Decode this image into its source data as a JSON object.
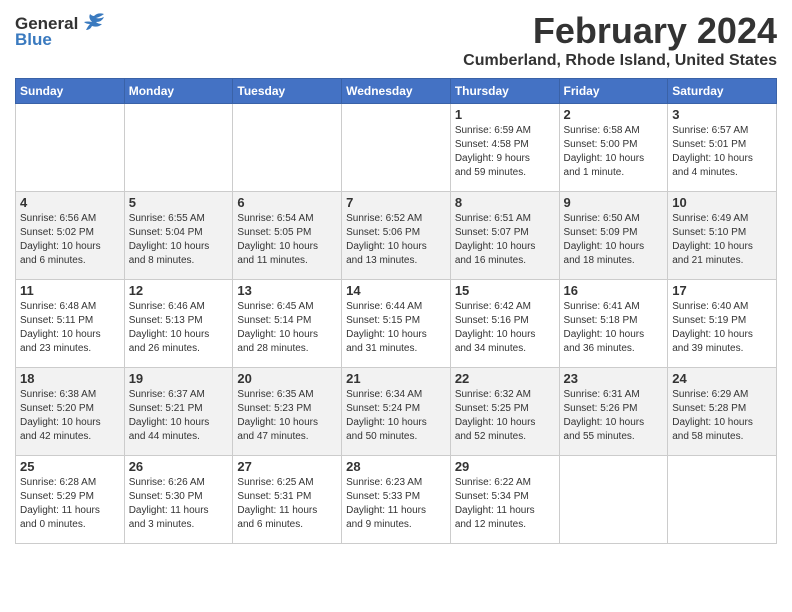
{
  "header": {
    "logo_line1": "General",
    "logo_line2": "Blue",
    "title": "February 2024",
    "subtitle": "Cumberland, Rhode Island, United States"
  },
  "days_of_week": [
    "Sunday",
    "Monday",
    "Tuesday",
    "Wednesday",
    "Thursday",
    "Friday",
    "Saturday"
  ],
  "weeks": [
    {
      "cells": [
        {
          "day": "",
          "info": ""
        },
        {
          "day": "",
          "info": ""
        },
        {
          "day": "",
          "info": ""
        },
        {
          "day": "",
          "info": ""
        },
        {
          "day": "1",
          "info": "Sunrise: 6:59 AM\nSunset: 4:58 PM\nDaylight: 9 hours\nand 59 minutes."
        },
        {
          "day": "2",
          "info": "Sunrise: 6:58 AM\nSunset: 5:00 PM\nDaylight: 10 hours\nand 1 minute."
        },
        {
          "day": "3",
          "info": "Sunrise: 6:57 AM\nSunset: 5:01 PM\nDaylight: 10 hours\nand 4 minutes."
        }
      ]
    },
    {
      "cells": [
        {
          "day": "4",
          "info": "Sunrise: 6:56 AM\nSunset: 5:02 PM\nDaylight: 10 hours\nand 6 minutes."
        },
        {
          "day": "5",
          "info": "Sunrise: 6:55 AM\nSunset: 5:04 PM\nDaylight: 10 hours\nand 8 minutes."
        },
        {
          "day": "6",
          "info": "Sunrise: 6:54 AM\nSunset: 5:05 PM\nDaylight: 10 hours\nand 11 minutes."
        },
        {
          "day": "7",
          "info": "Sunrise: 6:52 AM\nSunset: 5:06 PM\nDaylight: 10 hours\nand 13 minutes."
        },
        {
          "day": "8",
          "info": "Sunrise: 6:51 AM\nSunset: 5:07 PM\nDaylight: 10 hours\nand 16 minutes."
        },
        {
          "day": "9",
          "info": "Sunrise: 6:50 AM\nSunset: 5:09 PM\nDaylight: 10 hours\nand 18 minutes."
        },
        {
          "day": "10",
          "info": "Sunrise: 6:49 AM\nSunset: 5:10 PM\nDaylight: 10 hours\nand 21 minutes."
        }
      ]
    },
    {
      "cells": [
        {
          "day": "11",
          "info": "Sunrise: 6:48 AM\nSunset: 5:11 PM\nDaylight: 10 hours\nand 23 minutes."
        },
        {
          "day": "12",
          "info": "Sunrise: 6:46 AM\nSunset: 5:13 PM\nDaylight: 10 hours\nand 26 minutes."
        },
        {
          "day": "13",
          "info": "Sunrise: 6:45 AM\nSunset: 5:14 PM\nDaylight: 10 hours\nand 28 minutes."
        },
        {
          "day": "14",
          "info": "Sunrise: 6:44 AM\nSunset: 5:15 PM\nDaylight: 10 hours\nand 31 minutes."
        },
        {
          "day": "15",
          "info": "Sunrise: 6:42 AM\nSunset: 5:16 PM\nDaylight: 10 hours\nand 34 minutes."
        },
        {
          "day": "16",
          "info": "Sunrise: 6:41 AM\nSunset: 5:18 PM\nDaylight: 10 hours\nand 36 minutes."
        },
        {
          "day": "17",
          "info": "Sunrise: 6:40 AM\nSunset: 5:19 PM\nDaylight: 10 hours\nand 39 minutes."
        }
      ]
    },
    {
      "cells": [
        {
          "day": "18",
          "info": "Sunrise: 6:38 AM\nSunset: 5:20 PM\nDaylight: 10 hours\nand 42 minutes."
        },
        {
          "day": "19",
          "info": "Sunrise: 6:37 AM\nSunset: 5:21 PM\nDaylight: 10 hours\nand 44 minutes."
        },
        {
          "day": "20",
          "info": "Sunrise: 6:35 AM\nSunset: 5:23 PM\nDaylight: 10 hours\nand 47 minutes."
        },
        {
          "day": "21",
          "info": "Sunrise: 6:34 AM\nSunset: 5:24 PM\nDaylight: 10 hours\nand 50 minutes."
        },
        {
          "day": "22",
          "info": "Sunrise: 6:32 AM\nSunset: 5:25 PM\nDaylight: 10 hours\nand 52 minutes."
        },
        {
          "day": "23",
          "info": "Sunrise: 6:31 AM\nSunset: 5:26 PM\nDaylight: 10 hours\nand 55 minutes."
        },
        {
          "day": "24",
          "info": "Sunrise: 6:29 AM\nSunset: 5:28 PM\nDaylight: 10 hours\nand 58 minutes."
        }
      ]
    },
    {
      "cells": [
        {
          "day": "25",
          "info": "Sunrise: 6:28 AM\nSunset: 5:29 PM\nDaylight: 11 hours\nand 0 minutes."
        },
        {
          "day": "26",
          "info": "Sunrise: 6:26 AM\nSunset: 5:30 PM\nDaylight: 11 hours\nand 3 minutes."
        },
        {
          "day": "27",
          "info": "Sunrise: 6:25 AM\nSunset: 5:31 PM\nDaylight: 11 hours\nand 6 minutes."
        },
        {
          "day": "28",
          "info": "Sunrise: 6:23 AM\nSunset: 5:33 PM\nDaylight: 11 hours\nand 9 minutes."
        },
        {
          "day": "29",
          "info": "Sunrise: 6:22 AM\nSunset: 5:34 PM\nDaylight: 11 hours\nand 12 minutes."
        },
        {
          "day": "",
          "info": ""
        },
        {
          "day": "",
          "info": ""
        }
      ]
    }
  ]
}
